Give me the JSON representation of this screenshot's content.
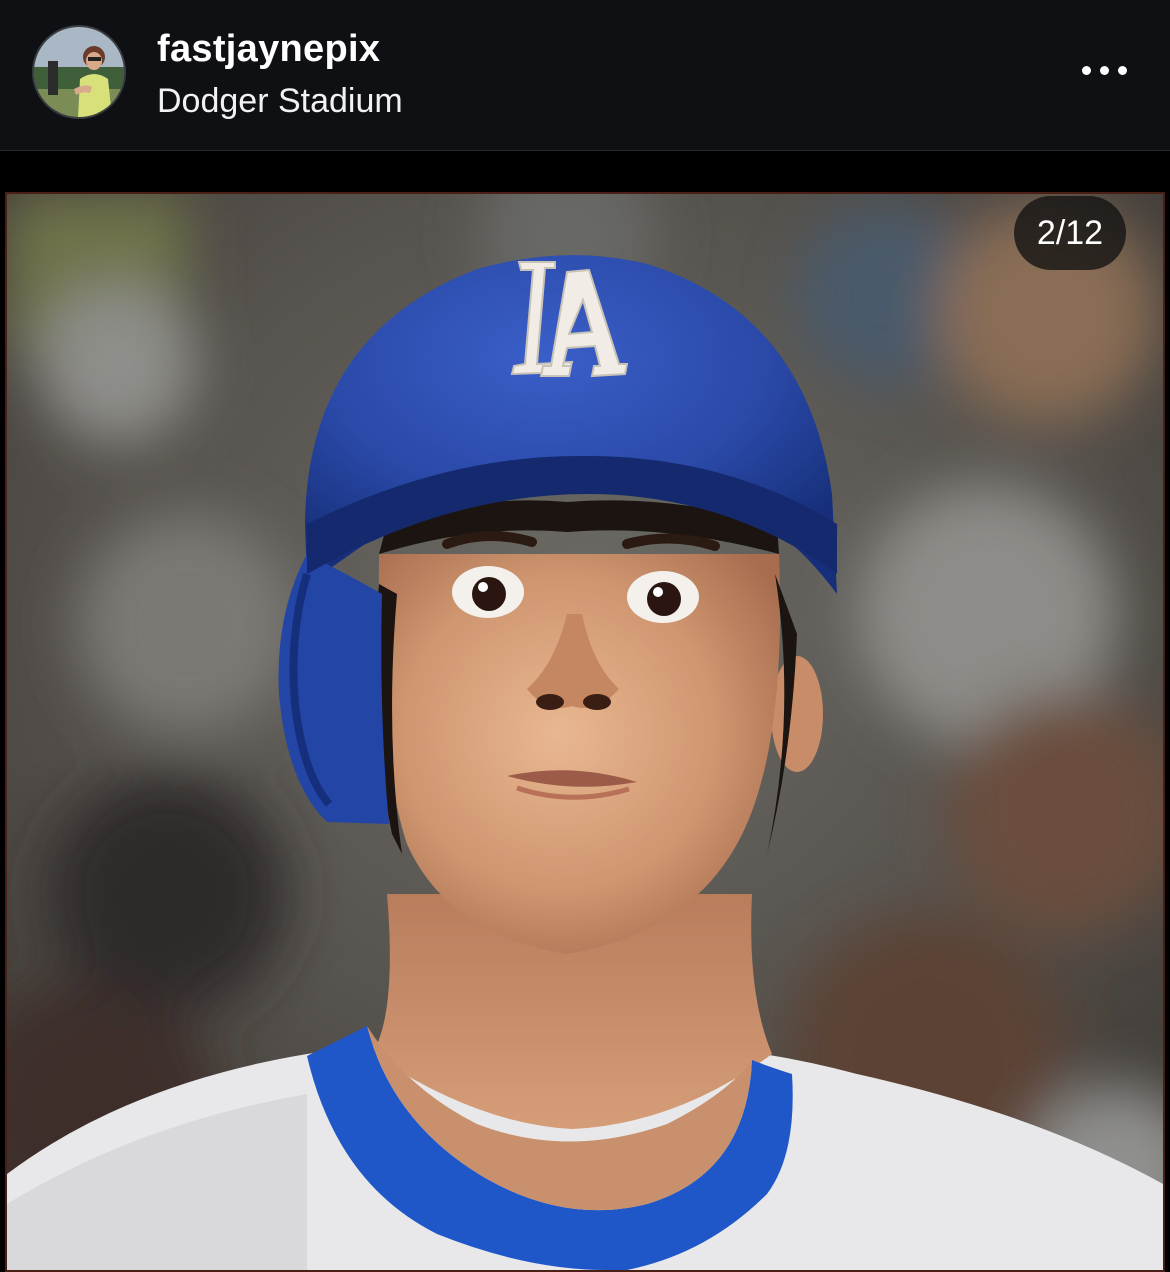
{
  "post": {
    "username": "fastjaynepix",
    "location": "Dodger Stadium",
    "media_counter": "2/12",
    "avatar_description": "profile photo",
    "more_icon": "more-horizontal-icon"
  },
  "photo": {
    "logo_text": "LA"
  },
  "colors": {
    "header_bg": "#0e1014",
    "page_bg": "#000000",
    "helmet_blue": "#2a49a8",
    "jersey_white": "#e8e8ea",
    "collar_blue": "#1f57c8"
  }
}
